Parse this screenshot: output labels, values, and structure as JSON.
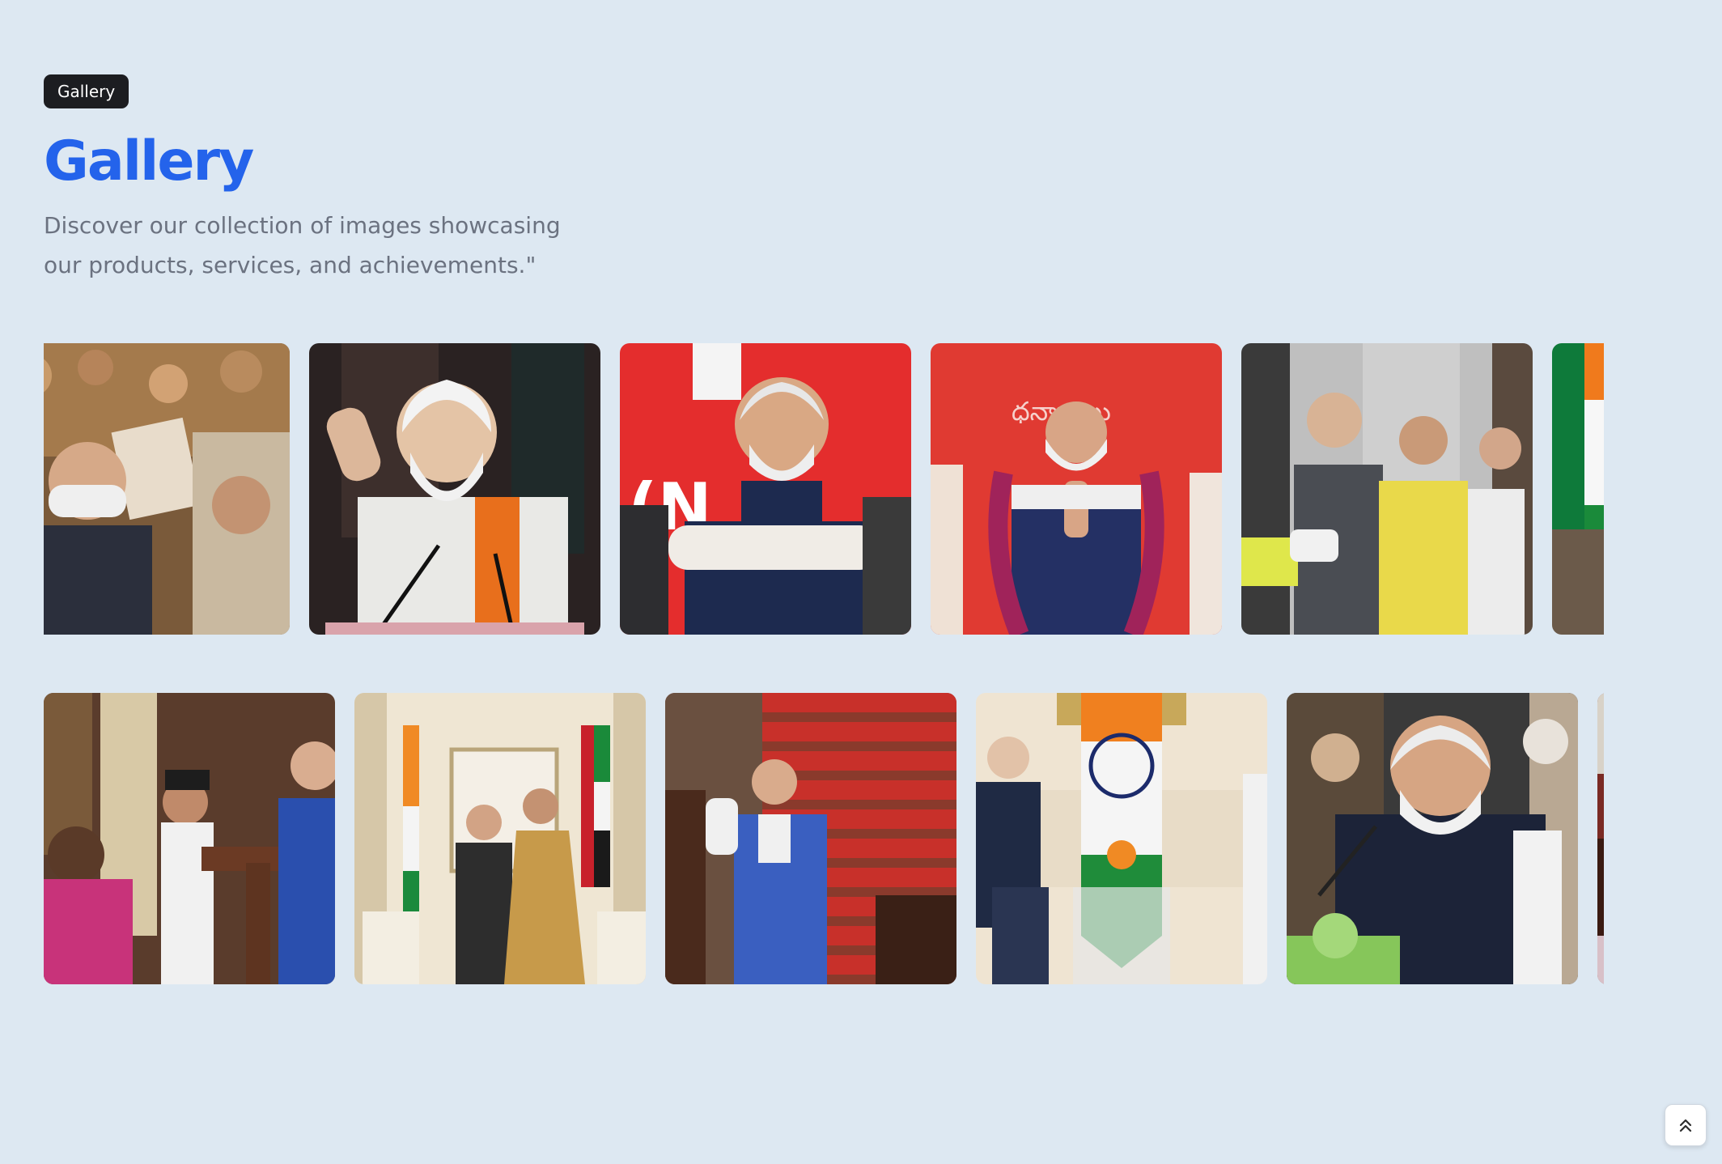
{
  "badge": "Gallery",
  "title": "Gallery",
  "subtitle": "Discover our collection of images showcasing our products, services, and achievements.\"",
  "gallery": {
    "row1": [
      {
        "icon": "photo-crowd-greeting"
      },
      {
        "icon": "photo-speaker-white-sweater"
      },
      {
        "icon": "photo-seated-red-backdrop"
      },
      {
        "icon": "photo-garland-namaste"
      },
      {
        "icon": "photo-group-standing"
      },
      {
        "icon": "photo-flags-partial"
      }
    ],
    "row2": [
      {
        "icon": "photo-podium-ceremony"
      },
      {
        "icon": "photo-handshake-flags"
      },
      {
        "icon": "photo-red-staircase-namaste"
      },
      {
        "icon": "photo-meeting-flag-center"
      },
      {
        "icon": "photo-conference-microphone"
      },
      {
        "icon": "photo-hall-partial"
      }
    ]
  },
  "scroll_top": {
    "icon": "double-chevron-up-icon"
  }
}
